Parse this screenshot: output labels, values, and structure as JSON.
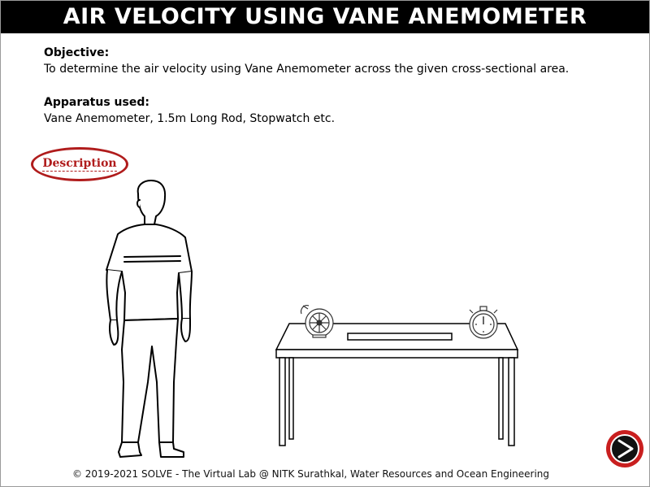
{
  "page": {
    "title": "AIR VELOCITY USING VANE ANEMOMETER"
  },
  "objective": {
    "heading": "Objective:",
    "text": "To determine the air velocity using Vane Anemometer across the given cross-sectional area."
  },
  "apparatus": {
    "heading": "Apparatus used:",
    "text": "Vane Anemometer, 1.5m Long Rod, Stopwatch etc."
  },
  "buttons": {
    "description_label": "Description",
    "next_icon": "next-arrow-icon"
  },
  "illustration": {
    "items": [
      "person-figure",
      "table",
      "vane-anemometer",
      "stopwatch",
      "long-rod"
    ]
  },
  "footer": {
    "text": "© 2019-2021 SOLVE - The Virtual Lab @ NITK Surathkal, Water Resources and Ocean Engineering"
  },
  "colors": {
    "title_bg": "#000000",
    "accent_red": "#b01c1c"
  }
}
